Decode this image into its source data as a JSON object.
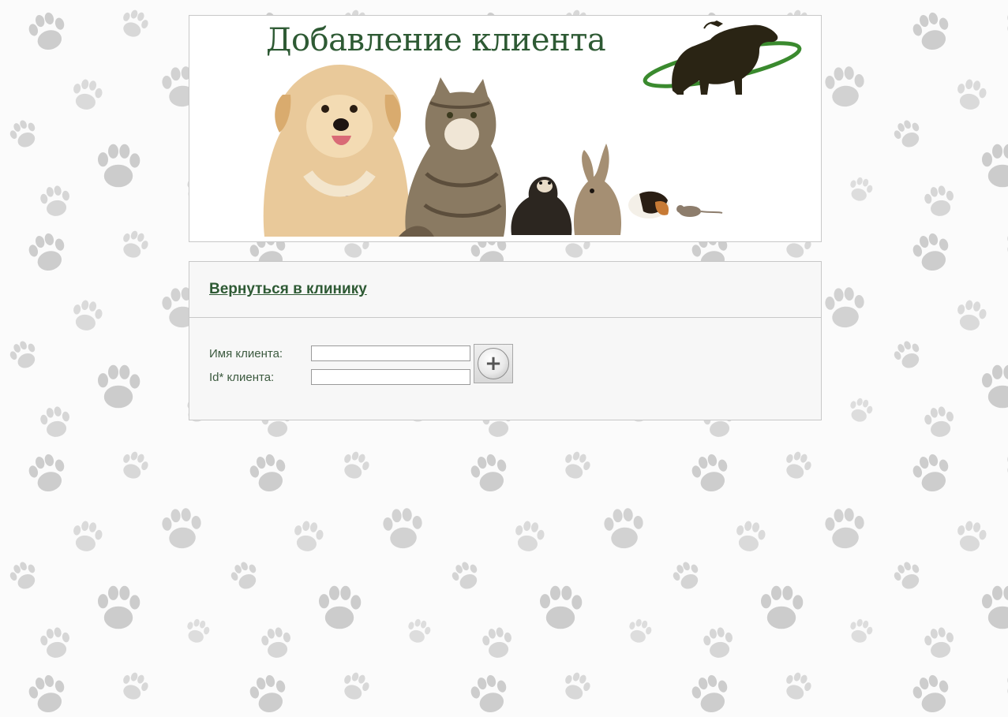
{
  "header": {
    "title": "Добавление клиента"
  },
  "nav": {
    "back_link": "Вернуться в клинику"
  },
  "form": {
    "name_label": "Имя клиента:",
    "name_value": "",
    "id_label": "Id* клиента:",
    "id_value": "",
    "add_button_icon": "plus-icon",
    "add_button_symbol": "+"
  },
  "colors": {
    "accent_green": "#2e5a34",
    "label_green": "#3c5a3f",
    "panel_bg": "#f7f7f7",
    "border": "#c8c8c8"
  }
}
